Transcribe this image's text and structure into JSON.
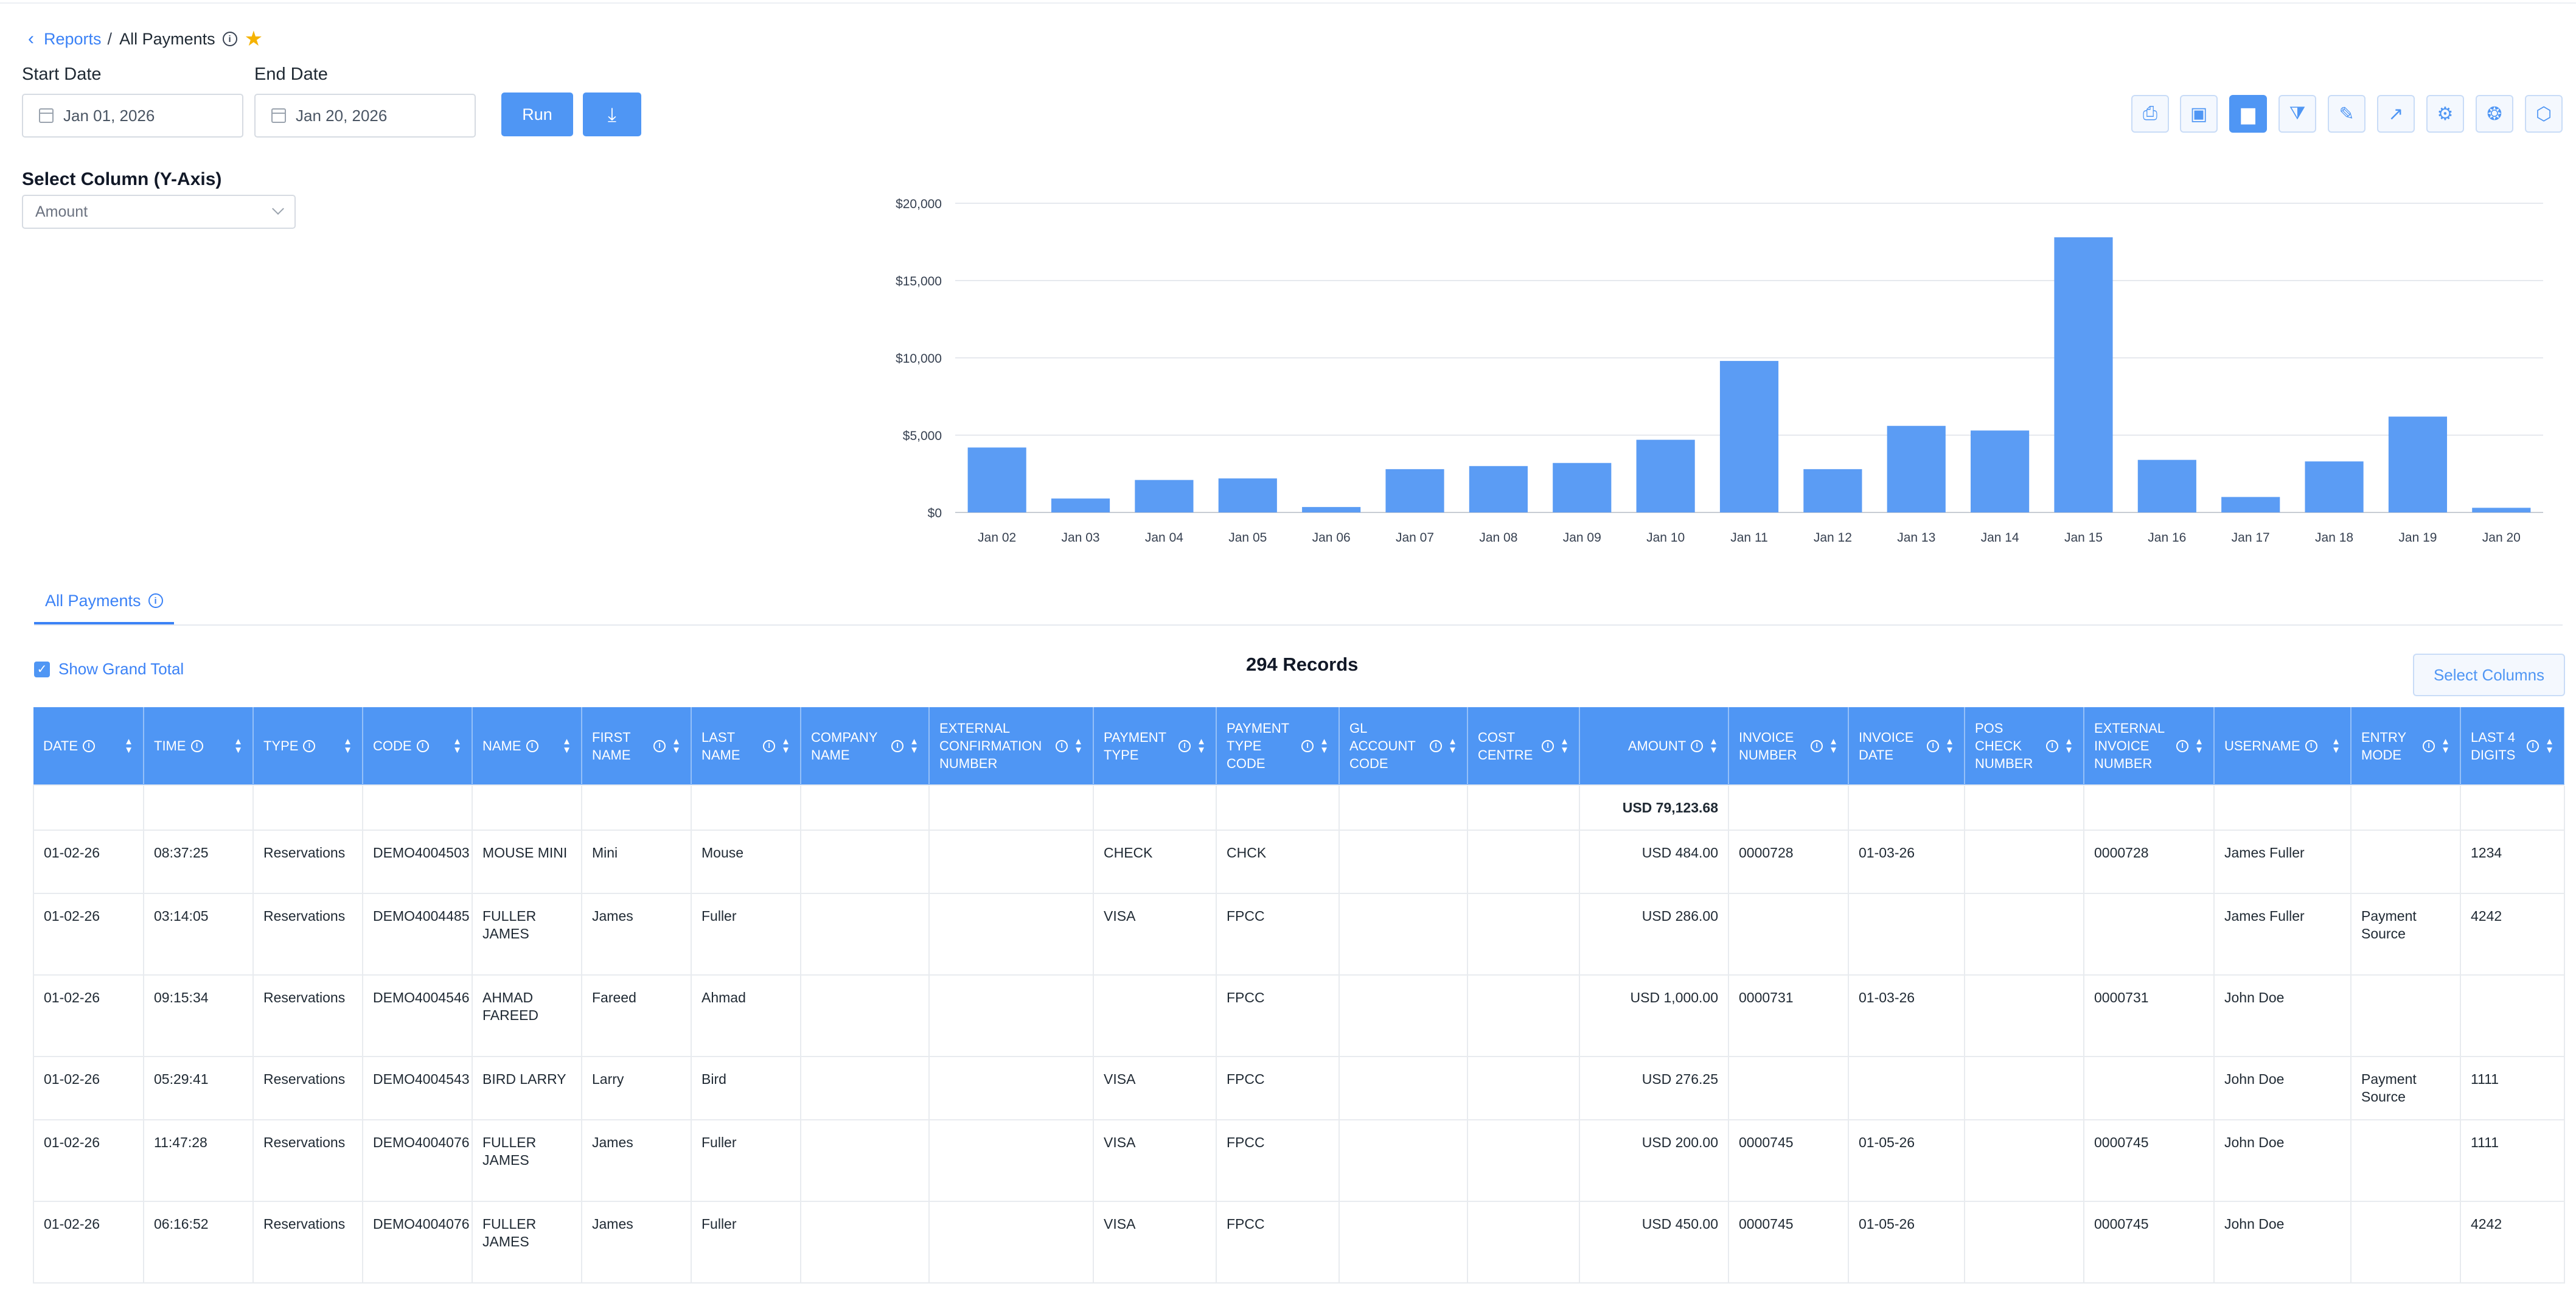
{
  "breadcrumb": {
    "parent": "Reports",
    "separator": "/",
    "current": "All Payments"
  },
  "filters": {
    "start_label": "Start Date",
    "start_value": "Jan 01, 2026",
    "end_label": "End Date",
    "end_value": "Jan 20, 2026",
    "run_label": "Run"
  },
  "y_axis": {
    "label": "Select Column (Y-Axis)",
    "value": "Amount"
  },
  "colors": {
    "accent": "#4f96f4",
    "star": "#f5b301"
  },
  "toolbar_icons": [
    "print-icon",
    "save-icon",
    "bar-chart-icon",
    "filter-icon",
    "edit-icon",
    "export-icon",
    "settings-icon",
    "scheduler-icon",
    "layers-icon"
  ],
  "chart_data": {
    "type": "bar",
    "categories": [
      "Jan 02",
      "Jan 03",
      "Jan 04",
      "Jan 05",
      "Jan 06",
      "Jan 07",
      "Jan 08",
      "Jan 09",
      "Jan 10",
      "Jan 11",
      "Jan 12",
      "Jan 13",
      "Jan 14",
      "Jan 15",
      "Jan 16",
      "Jan 17",
      "Jan 18",
      "Jan 19",
      "Jan 20"
    ],
    "values": [
      4200,
      900,
      2100,
      2200,
      350,
      2800,
      3000,
      3200,
      4700,
      9800,
      2800,
      5600,
      5300,
      17800,
      3400,
      1000,
      3300,
      6200,
      300
    ],
    "ylim": [
      0,
      20000
    ],
    "yticks": [
      "$0",
      "$5,000",
      "$10,000",
      "$15,000",
      "$20,000"
    ],
    "ytick_values": [
      0,
      5000,
      10000,
      15000,
      20000
    ],
    "grid": true,
    "color": "#5b9cf4"
  },
  "tab": {
    "label": "All Payments"
  },
  "table_meta": {
    "grand_total_label": "Show Grand Total",
    "records": "294 Records",
    "select_columns": "Select Columns"
  },
  "table": {
    "columns": [
      "DATE",
      "TIME",
      "TYPE",
      "CODE",
      "NAME",
      "FIRST NAME",
      "LAST NAME",
      "COMPANY NAME",
      "EXTERNAL CONFIRMATION NUMBER",
      "PAYMENT TYPE",
      "PAYMENT TYPE CODE",
      "GL ACCOUNT CODE",
      "COST CENTRE",
      "AMOUNT",
      "INVOICE NUMBER",
      "INVOICE DATE",
      "POS CHECK NUMBER",
      "EXTERNAL INVOICE NUMBER",
      "USERNAME",
      "ENTRY MODE",
      "LAST 4 DIGITS"
    ],
    "grand_total": [
      "",
      "",
      "",
      "",
      "",
      "",
      "",
      "",
      "",
      "",
      "",
      "",
      "",
      "USD 79,123.68",
      "",
      "",
      "",
      "",
      "",
      "",
      ""
    ],
    "rows": [
      [
        "01-02-26",
        "08:37:25",
        "Reservations",
        "DEMO4004503",
        "MOUSE MINI",
        "Mini",
        "Mouse",
        "",
        "",
        "CHECK",
        "CHCK",
        "",
        "",
        "USD 484.00",
        "0000728",
        "01-03-26",
        "",
        "0000728",
        "James Fuller",
        "",
        "1234"
      ],
      [
        "01-02-26",
        "03:14:05",
        "Reservations",
        "DEMO4004485",
        "FULLER JAMES",
        "James",
        "Fuller",
        "",
        "",
        "VISA",
        "FPCC",
        "",
        "",
        "USD 286.00",
        "",
        "",
        "",
        "",
        "James Fuller",
        "Payment Source",
        "4242"
      ],
      [
        "01-02-26",
        "09:15:34",
        "Reservations",
        "DEMO4004546",
        "AHMAD FAREED",
        "Fareed",
        "Ahmad",
        "",
        "",
        "",
        "FPCC",
        "",
        "",
        "USD 1,000.00",
        "0000731",
        "01-03-26",
        "",
        "0000731",
        "John Doe",
        "",
        ""
      ],
      [
        "01-02-26",
        "05:29:41",
        "Reservations",
        "DEMO4004543",
        "BIRD LARRY",
        "Larry",
        "Bird",
        "",
        "",
        "VISA",
        "FPCC",
        "",
        "",
        "USD 276.25",
        "",
        "",
        "",
        "",
        "John Doe",
        "Payment Source",
        "1111"
      ],
      [
        "01-02-26",
        "11:47:28",
        "Reservations",
        "DEMO4004076",
        "FULLER JAMES",
        "James",
        "Fuller",
        "",
        "",
        "VISA",
        "FPCC",
        "",
        "",
        "USD 200.00",
        "0000745",
        "01-05-26",
        "",
        "0000745",
        "John Doe",
        "",
        "1111"
      ],
      [
        "01-02-26",
        "06:16:52",
        "Reservations",
        "DEMO4004076",
        "FULLER JAMES",
        "James",
        "Fuller",
        "",
        "",
        "VISA",
        "FPCC",
        "",
        "",
        "USD 450.00",
        "0000745",
        "01-05-26",
        "",
        "0000745",
        "John Doe",
        "",
        "4242"
      ]
    ]
  }
}
